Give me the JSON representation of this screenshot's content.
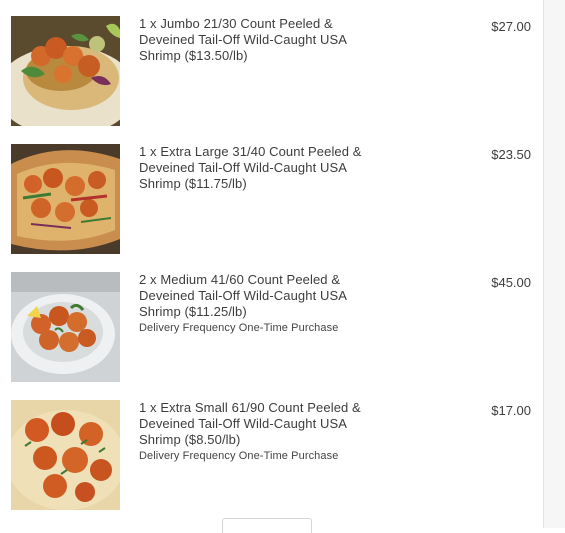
{
  "cart": {
    "items": [
      {
        "description": "1 x Jumbo 21/30 Count Peeled & Deveined Tail-Off Wild-Caught USA Shrimp ($13.50/lb)",
        "price": "$27.00",
        "image": "shrimp-tacos-image"
      },
      {
        "description": "1 x Extra Large 31/40 Count Peeled & Deveined Tail-Off Wild-Caught USA Shrimp ($11.75/lb)",
        "price": "$23.50",
        "image": "shrimp-flatbread-image"
      },
      {
        "description": "2 x Medium 41/60 Count Peeled & Deveined Tail-Off Wild-Caught USA Shrimp ($11.25/lb)",
        "frequency": "Delivery Frequency One-Time Purchase",
        "price": "$45.00",
        "image": "shrimp-plate-image"
      },
      {
        "description": "1 x Extra Small 61/90 Count Peeled & Deveined Tail-Off Wild-Caught USA Shrimp ($8.50/lb)",
        "frequency": "Delivery Frequency One-Time Purchase",
        "price": "$17.00",
        "image": "shrimp-grits-image"
      }
    ]
  },
  "colors": {
    "text": "#3d3d3d",
    "panel": "#f6f6f6",
    "border": "#e3e3e3"
  }
}
